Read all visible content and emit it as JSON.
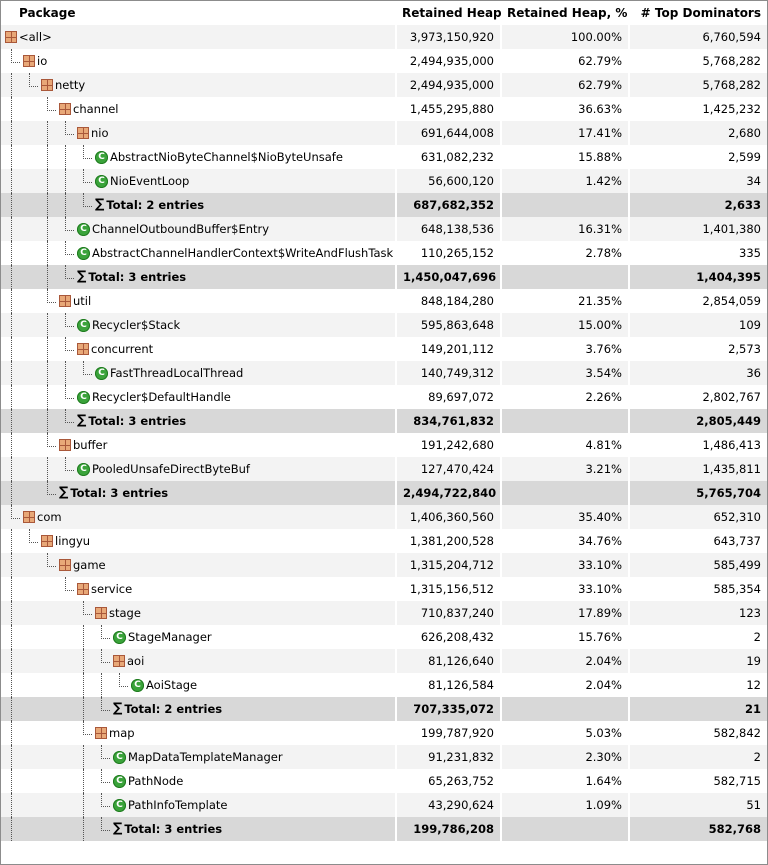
{
  "columns": {
    "package": "Package",
    "retained_heap": "Retained Heap",
    "retained_pct": "Retained Heap, %",
    "top_dominators": "# Top Dominators"
  },
  "rows": [
    {
      "type": "pkg",
      "label": "<all>",
      "heap": "3,973,150,920",
      "pct": "100.00%",
      "dom": "6,760,594"
    },
    {
      "type": "pkg",
      "label": "io",
      "heap": "2,494,935,000",
      "pct": "62.79%",
      "dom": "5,768,282"
    },
    {
      "type": "pkg",
      "label": "netty",
      "heap": "2,494,935,000",
      "pct": "62.79%",
      "dom": "5,768,282"
    },
    {
      "type": "pkg",
      "label": "channel",
      "heap": "1,455,295,880",
      "pct": "36.63%",
      "dom": "1,425,232"
    },
    {
      "type": "pkg",
      "label": "nio",
      "heap": "691,644,008",
      "pct": "17.41%",
      "dom": "2,680"
    },
    {
      "type": "cls",
      "label": "AbstractNioByteChannel$NioByteUnsafe",
      "heap": "631,082,232",
      "pct": "15.88%",
      "dom": "2,599"
    },
    {
      "type": "cls",
      "label": "NioEventLoop",
      "heap": "56,600,120",
      "pct": "1.42%",
      "dom": "34"
    },
    {
      "type": "total",
      "label": "Total: 2 entries",
      "heap": "687,682,352",
      "pct": "",
      "dom": "2,633"
    },
    {
      "type": "cls",
      "label": "ChannelOutboundBuffer$Entry",
      "heap": "648,138,536",
      "pct": "16.31%",
      "dom": "1,401,380"
    },
    {
      "type": "cls",
      "label": "AbstractChannelHandlerContext$WriteAndFlushTask",
      "heap": "110,265,152",
      "pct": "2.78%",
      "dom": "335"
    },
    {
      "type": "total",
      "label": "Total: 3 entries",
      "heap": "1,450,047,696",
      "pct": "",
      "dom": "1,404,395"
    },
    {
      "type": "pkg",
      "label": "util",
      "heap": "848,184,280",
      "pct": "21.35%",
      "dom": "2,854,059"
    },
    {
      "type": "cls",
      "label": "Recycler$Stack",
      "heap": "595,863,648",
      "pct": "15.00%",
      "dom": "109"
    },
    {
      "type": "pkg",
      "label": "concurrent",
      "heap": "149,201,112",
      "pct": "3.76%",
      "dom": "2,573"
    },
    {
      "type": "cls",
      "label": "FastThreadLocalThread",
      "heap": "140,749,312",
      "pct": "3.54%",
      "dom": "36"
    },
    {
      "type": "cls",
      "label": "Recycler$DefaultHandle",
      "heap": "89,697,072",
      "pct": "2.26%",
      "dom": "2,802,767"
    },
    {
      "type": "total",
      "label": "Total: 3 entries",
      "heap": "834,761,832",
      "pct": "",
      "dom": "2,805,449"
    },
    {
      "type": "pkg",
      "label": "buffer",
      "heap": "191,242,680",
      "pct": "4.81%",
      "dom": "1,486,413"
    },
    {
      "type": "cls",
      "label": "PooledUnsafeDirectByteBuf",
      "heap": "127,470,424",
      "pct": "3.21%",
      "dom": "1,435,811"
    },
    {
      "type": "total",
      "label": "Total: 3 entries",
      "heap": "2,494,722,840",
      "pct": "",
      "dom": "5,765,704"
    },
    {
      "type": "pkg",
      "label": "com",
      "heap": "1,406,360,560",
      "pct": "35.40%",
      "dom": "652,310"
    },
    {
      "type": "pkg",
      "label": "lingyu",
      "heap": "1,381,200,528",
      "pct": "34.76%",
      "dom": "643,737"
    },
    {
      "type": "pkg",
      "label": "game",
      "heap": "1,315,204,712",
      "pct": "33.10%",
      "dom": "585,499"
    },
    {
      "type": "pkg",
      "label": "service",
      "heap": "1,315,156,512",
      "pct": "33.10%",
      "dom": "585,354"
    },
    {
      "type": "pkg",
      "label": "stage",
      "heap": "710,837,240",
      "pct": "17.89%",
      "dom": "123"
    },
    {
      "type": "cls",
      "label": "StageManager",
      "heap": "626,208,432",
      "pct": "15.76%",
      "dom": "2"
    },
    {
      "type": "pkg",
      "label": "aoi",
      "heap": "81,126,640",
      "pct": "2.04%",
      "dom": "19"
    },
    {
      "type": "cls",
      "label": "AoiStage",
      "heap": "81,126,584",
      "pct": "2.04%",
      "dom": "12"
    },
    {
      "type": "total",
      "label": "Total: 2 entries",
      "heap": "707,335,072",
      "pct": "",
      "dom": "21"
    },
    {
      "type": "pkg",
      "label": "map",
      "heap": "199,787,920",
      "pct": "5.03%",
      "dom": "582,842"
    },
    {
      "type": "cls",
      "label": "MapDataTemplateManager",
      "heap": "91,231,832",
      "pct": "2.30%",
      "dom": "2"
    },
    {
      "type": "cls",
      "label": "PathNode",
      "heap": "65,263,752",
      "pct": "1.64%",
      "dom": "582,715"
    },
    {
      "type": "cls",
      "label": "PathInfoTemplate",
      "heap": "43,290,624",
      "pct": "1.09%",
      "dom": "51"
    },
    {
      "type": "total",
      "label": "Total: 3 entries",
      "heap": "199,786,208",
      "pct": "",
      "dom": "582,768"
    }
  ]
}
